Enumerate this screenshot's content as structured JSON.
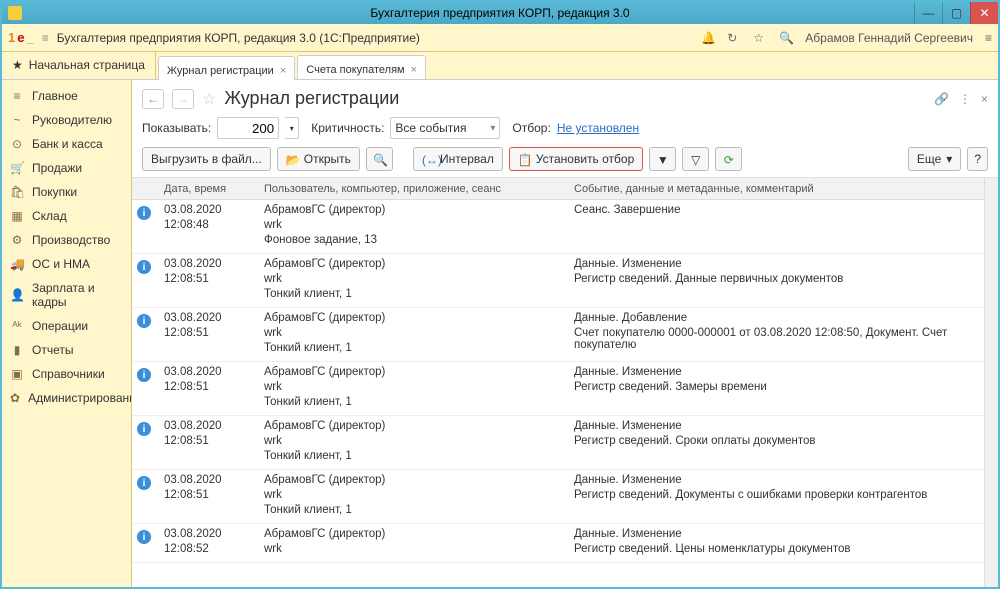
{
  "window": {
    "title": "Бухгалтерия предприятия КОРП, редакция 3.0"
  },
  "appbar": {
    "title": "Бухгалтерия предприятия КОРП, редакция 3.0  (1С:Предприятие)",
    "user": "Абрамов Геннадий Сергеевич"
  },
  "tabs": {
    "home": "Начальная страница",
    "items": [
      {
        "label": "Журнал регистрации",
        "active": true
      },
      {
        "label": "Счета покупателям",
        "active": false
      }
    ]
  },
  "sidebar": {
    "items": [
      {
        "icon": "≡",
        "label": "Главное"
      },
      {
        "icon": "~",
        "label": "Руководителю"
      },
      {
        "icon": "⊙",
        "label": "Банк и касса"
      },
      {
        "icon": "🛒",
        "label": "Продажи"
      },
      {
        "icon": "🛍",
        "label": "Покупки"
      },
      {
        "icon": "▦",
        "label": "Склад"
      },
      {
        "icon": "⚙",
        "label": "Производство"
      },
      {
        "icon": "🚚",
        "label": "ОС и НМА"
      },
      {
        "icon": "👤",
        "label": "Зарплата и кадры"
      },
      {
        "icon": "ᴬᵏ",
        "label": "Операции"
      },
      {
        "icon": "▮",
        "label": "Отчеты"
      },
      {
        "icon": "▣",
        "label": "Справочники"
      },
      {
        "icon": "✿",
        "label": "Администрирование"
      }
    ]
  },
  "page": {
    "title": "Журнал регистрации"
  },
  "filter": {
    "show_label": "Показывать:",
    "show_value": "200",
    "severity_label": "Критичность:",
    "severity_value": "Все события",
    "selection_label": "Отбор:",
    "selection_link": "Не установлен"
  },
  "toolbar": {
    "export": "Выгрузить в файл...",
    "open": "Открыть",
    "interval": "Интервал",
    "set_filter": "Установить отбор",
    "more": "Еще"
  },
  "table": {
    "headers": {
      "c1": "Дата, время",
      "c2": "Пользователь, компьютер, приложение, сеанс",
      "c3": "Событие, данные и метаданные, комментарий"
    },
    "rows": [
      {
        "date": "03.08.2020",
        "time": "12:08:48",
        "user": "АбрамовГС (директор)",
        "comp": "wrk",
        "app": "Фоновое задание, 13",
        "event": "Сеанс. Завершение",
        "detail1": "",
        "detail2": ""
      },
      {
        "date": "03.08.2020",
        "time": "12:08:51",
        "user": "АбрамовГС (директор)",
        "comp": "wrk",
        "app": "Тонкий клиент, 1",
        "event": "Данные. Изменение",
        "detail1": "Регистр сведений. Данные первичных документов",
        "detail2": ""
      },
      {
        "date": "03.08.2020",
        "time": "12:08:51",
        "user": "АбрамовГС (директор)",
        "comp": "wrk",
        "app": "Тонкий клиент, 1",
        "event": "Данные. Добавление",
        "detail1": "Счет покупателю 0000-000001 от 03.08.2020 12:08:50, Документ. Счет покупателю",
        "detail2": ""
      },
      {
        "date": "03.08.2020",
        "time": "12:08:51",
        "user": "АбрамовГС (директор)",
        "comp": "wrk",
        "app": "Тонкий клиент, 1",
        "event": "Данные. Изменение",
        "detail1": "Регистр сведений. Замеры времени",
        "detail2": ""
      },
      {
        "date": "03.08.2020",
        "time": "12:08:51",
        "user": "АбрамовГС (директор)",
        "comp": "wrk",
        "app": "Тонкий клиент, 1",
        "event": "Данные. Изменение",
        "detail1": "Регистр сведений. Сроки оплаты документов",
        "detail2": ""
      },
      {
        "date": "03.08.2020",
        "time": "12:08:51",
        "user": "АбрамовГС (директор)",
        "comp": "wrk",
        "app": "Тонкий клиент, 1",
        "event": "Данные. Изменение",
        "detail1": "Регистр сведений. Документы с ошибками проверки контрагентов",
        "detail2": ""
      },
      {
        "date": "03.08.2020",
        "time": "12:08:52",
        "user": "АбрамовГС (директор)",
        "comp": "wrk",
        "app": "",
        "event": "Данные. Изменение",
        "detail1": "Регистр сведений. Цены номенклатуры документов",
        "detail2": ""
      }
    ]
  }
}
